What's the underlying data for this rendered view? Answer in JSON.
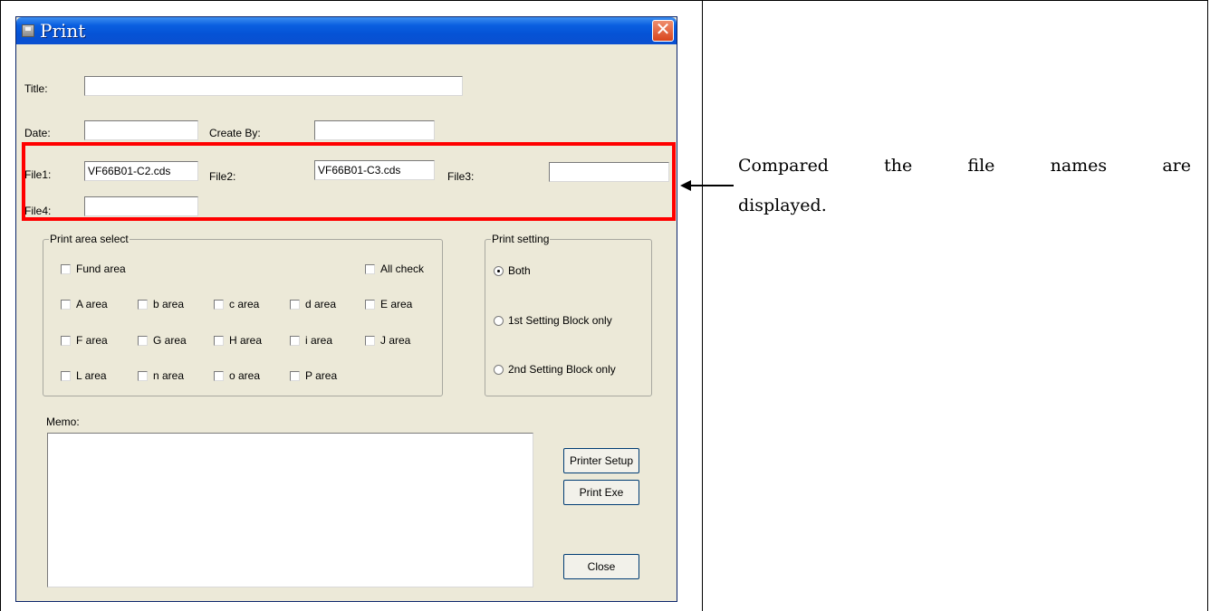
{
  "window": {
    "title": "Print",
    "close_glyph": "✕"
  },
  "form": {
    "title_label": "Title:",
    "title_value": "",
    "date_label": "Date:",
    "date_value": "",
    "create_by_label": "Create By:",
    "create_by_value": "",
    "file1_label": "File1:",
    "file1_value": "VF66B01-C2.cds",
    "file2_label": "File2:",
    "file2_value": "VF66B01-C3.cds",
    "file3_label": "File3:",
    "file3_value": "",
    "file4_label": "File4:",
    "file4_value": ""
  },
  "print_area": {
    "legend": "Print area select",
    "fund": "Fund area",
    "all_check": "All check",
    "row1": [
      "A area",
      "b area",
      "c area",
      "d area",
      "E area"
    ],
    "row2": [
      "F area",
      "G area",
      "H area",
      "i area",
      "J area"
    ],
    "row3": [
      "L area",
      "n area",
      "o area",
      "P area"
    ]
  },
  "print_setting": {
    "legend": "Print setting",
    "options": [
      "Both",
      "1st Setting Block only",
      "2nd Setting Block only"
    ],
    "selected": "Both"
  },
  "memo": {
    "label": "Memo:",
    "value": ""
  },
  "buttons": {
    "printer_setup": "Printer Setup",
    "print_exe": "Print Exe",
    "close": "Close"
  },
  "annotation": {
    "line1": "Compared the file names are",
    "line2": "displayed."
  },
  "colors": {
    "highlight": "#ff0000",
    "titlebar": "#0a5fe0",
    "dialog_bg": "#ece9d8"
  }
}
